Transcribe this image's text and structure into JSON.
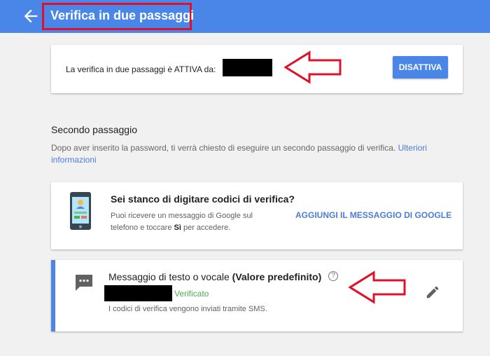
{
  "header": {
    "title": "Verifica in due passaggi",
    "back_icon": "arrow-left-icon"
  },
  "status_card": {
    "text": "La verifica in due passaggi è ATTIVA da:",
    "button_label": "DISATTIVA"
  },
  "second_step": {
    "title": "Secondo passaggio",
    "description": "Dopo aver inserito la password, ti verrà chiesto di eseguire un secondo passaggio di verifica. ",
    "link": "Ulteriori informazioni"
  },
  "prompt_card": {
    "icon": "phone-icon",
    "title": "Sei stanco di digitare codici di verifica?",
    "description_before": "Puoi ricevere un messaggio di Google sul telefono e toccare ",
    "description_bold": "Sì",
    "description_after": " per accedere.",
    "action": "AGGIUNGI IL MESSAGGIO DI GOOGLE"
  },
  "sms_card": {
    "icon": "sms-icon",
    "title": "Messaggio di testo o vocale",
    "title_suffix": "(Valore predefinito)",
    "help_glyph": "?",
    "status": "Verificato",
    "description": "I codici di verifica vengono inviati tramite SMS.",
    "edit_icon": "pencil-icon"
  },
  "colors": {
    "header": "#4a86e8",
    "accent": "#4a86e8",
    "annotation_red": "#e0102b",
    "verified_green": "#4caf50",
    "link_blue": "#4a7ed6"
  }
}
